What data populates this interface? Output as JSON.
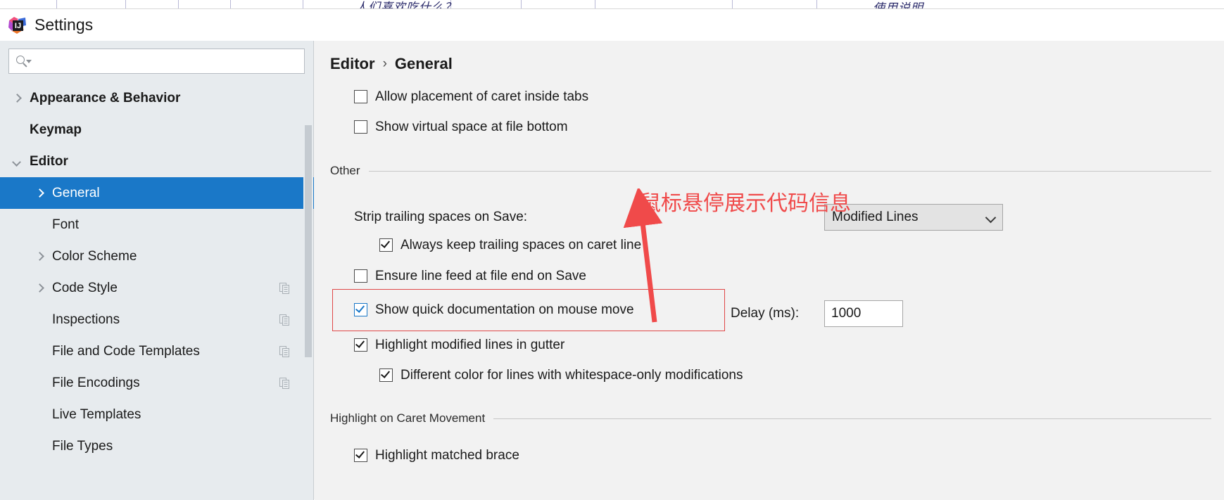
{
  "window": {
    "title": "Settings",
    "app_icon": "intellij-idea-logo"
  },
  "background_page": {
    "ghost_text_1": "人们喜欢吃什么？",
    "ghost_text_2": "使用说明"
  },
  "search": {
    "value": "",
    "placeholder": "",
    "icon": "search-icon"
  },
  "sidebar": {
    "items": [
      {
        "label": "Appearance & Behavior",
        "chevron": "right",
        "indent": 18,
        "bold": true,
        "selected": false,
        "copy_icon": false
      },
      {
        "label": "Keymap",
        "chevron": "none",
        "indent": 18,
        "bold": true,
        "selected": false,
        "copy_icon": false
      },
      {
        "label": "Editor",
        "chevron": "down",
        "indent": 18,
        "bold": true,
        "selected": false,
        "copy_icon": false
      },
      {
        "label": "General",
        "chevron": "right",
        "indent": 50,
        "bold": false,
        "selected": true,
        "copy_icon": false
      },
      {
        "label": "Font",
        "chevron": "none",
        "indent": 50,
        "bold": false,
        "selected": false,
        "copy_icon": false
      },
      {
        "label": "Color Scheme",
        "chevron": "right",
        "indent": 50,
        "bold": false,
        "selected": false,
        "copy_icon": false
      },
      {
        "label": "Code Style",
        "chevron": "right",
        "indent": 50,
        "bold": false,
        "selected": false,
        "copy_icon": true
      },
      {
        "label": "Inspections",
        "chevron": "none",
        "indent": 50,
        "bold": false,
        "selected": false,
        "copy_icon": true
      },
      {
        "label": "File and Code Templates",
        "chevron": "none",
        "indent": 50,
        "bold": false,
        "selected": false,
        "copy_icon": true
      },
      {
        "label": "File Encodings",
        "chevron": "none",
        "indent": 50,
        "bold": false,
        "selected": false,
        "copy_icon": true
      },
      {
        "label": "Live Templates",
        "chevron": "none",
        "indent": 50,
        "bold": false,
        "selected": false,
        "copy_icon": false
      },
      {
        "label": "File Types",
        "chevron": "none",
        "indent": 50,
        "bold": false,
        "selected": false,
        "copy_icon": false
      }
    ]
  },
  "breadcrumb": {
    "root": "Editor",
    "separator": "›",
    "current": "General"
  },
  "main": {
    "top_checkboxes": [
      {
        "label": "Allow placement of caret inside tabs",
        "checked": false
      },
      {
        "label": "Show virtual space at file bottom",
        "checked": false
      }
    ],
    "other_section": {
      "title": "Other",
      "strip_label": "Strip trailing spaces on Save:",
      "strip_value": "Modified Lines",
      "checkboxes": [
        {
          "label": "Always keep trailing spaces on caret line",
          "checked": true,
          "style": "dark"
        },
        {
          "label": "Ensure line feed at file end on Save",
          "checked": false,
          "style": "dark"
        },
        {
          "label": "Show quick documentation on mouse move",
          "checked": true,
          "style": "blue"
        },
        {
          "label": "Highlight modified lines in gutter",
          "checked": true,
          "style": "dark"
        },
        {
          "label": "Different color for lines with whitespace-only modifications",
          "checked": true,
          "style": "dark"
        }
      ],
      "delay_label": "Delay (ms):",
      "delay_value": "1000"
    },
    "caret_section": {
      "title": "Highlight on Caret Movement",
      "first_item": "Highlight matched brace"
    }
  },
  "annotation": {
    "text": "鼠标悬停展示代码信息",
    "color": "#f04a4a",
    "highlight_box_color": "#e04848"
  },
  "colors": {
    "accent": "#1a78c8",
    "sidebar_bg": "#e7ebee",
    "panel_bg": "#f2f2f2",
    "annotation_red": "#f04a4a"
  }
}
